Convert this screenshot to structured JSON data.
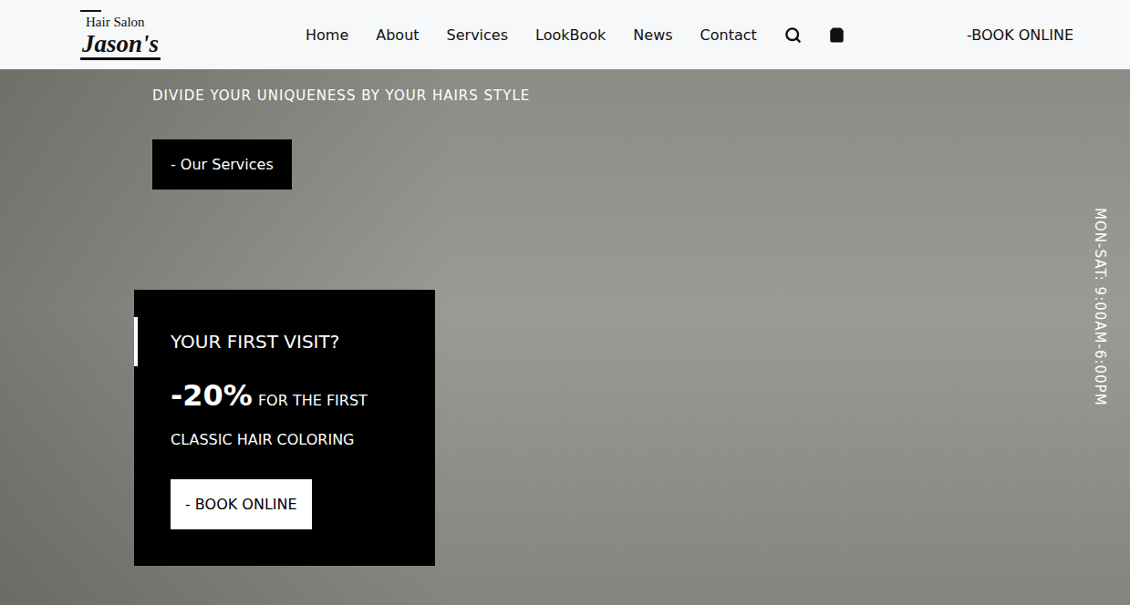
{
  "header": {
    "logo": {
      "top": "Hair Salon",
      "name": "Jason's"
    },
    "nav": [
      "Home",
      "About",
      "Services",
      "LookBook",
      "News",
      "Contact"
    ],
    "cta": "-BOOK ONLINE"
  },
  "hero": {
    "subtitle": "DIVIDE YOUR UNIQUENESS BY YOUR HAIRS STYLE",
    "button": "- Our Services",
    "hours": "MON-SAT: 9:00AM-6:00PM"
  },
  "promo": {
    "title": "YOUR FIRST VISIT?",
    "discount": "-20%",
    "line1": "FOR THE FIRST",
    "line2": "CLASSIC HAIR COLORING",
    "button": "- BOOK ONLINE"
  }
}
